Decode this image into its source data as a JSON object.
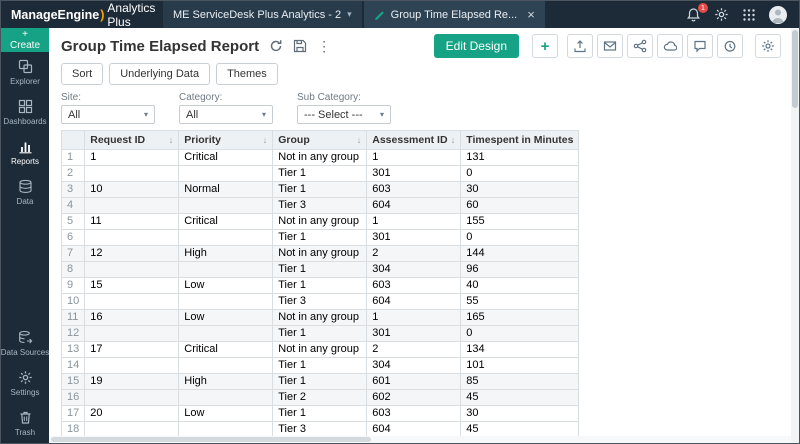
{
  "colors": {
    "topbar_bg": "#1d2b38",
    "accent_teal": "#16a385",
    "brand_orange": "#f7a800",
    "badge_red": "#e64a45",
    "header_bg": "#eef1f3",
    "row_alt_bg": "#f4f6f8",
    "grid_border": "#d9dee3"
  },
  "topbar": {
    "brand": "ManageEngine",
    "brand_accent": ")",
    "product": "Analytics Plus",
    "workspace_tab_label": "ME ServiceDesk Plus Analytics - 2",
    "workspace_caret": "▾",
    "report_tab_label": "Group Time Elapsed Re...",
    "close_glyph": "×",
    "notification_badge": "1"
  },
  "sidebar": {
    "create_label": "+ Create",
    "items": [
      {
        "label": "Explorer"
      },
      {
        "label": "Dashboards"
      },
      {
        "label": "Reports"
      },
      {
        "label": "Data"
      },
      {
        "label": "Data Sources"
      },
      {
        "label": "Settings"
      },
      {
        "label": "Trash"
      }
    ]
  },
  "report": {
    "title": "Group Time Elapsed Report",
    "more_glyph": "⋮",
    "edit_design_label": "Edit Design",
    "plus_glyph": "+",
    "action_buttons": [
      "Sort",
      "Underlying Data",
      "Themes"
    ]
  },
  "filters": {
    "site": {
      "label": "Site:",
      "value": "All"
    },
    "category": {
      "label": "Category:",
      "value": "All"
    },
    "sub_category": {
      "label": "Sub Category:",
      "value": "--- Select ---"
    }
  },
  "table": {
    "sort_glyph": "↓",
    "headers": [
      "Request ID",
      "Priority",
      "Group",
      "Assessment ID",
      "Timespent in Minutes"
    ],
    "rows": [
      {
        "n": "1",
        "cells": [
          "1",
          "Critical",
          "Not in any group",
          "1",
          "131"
        ]
      },
      {
        "n": "2",
        "cells": [
          "",
          "",
          "Tier 1",
          "301",
          "0"
        ]
      },
      {
        "n": "3",
        "cells": [
          "10",
          "Normal",
          "Tier 1",
          "603",
          "30"
        ]
      },
      {
        "n": "4",
        "cells": [
          "",
          "",
          "Tier 3",
          "604",
          "60"
        ]
      },
      {
        "n": "5",
        "cells": [
          "11",
          "Critical",
          "Not in any group",
          "1",
          "155"
        ]
      },
      {
        "n": "6",
        "cells": [
          "",
          "",
          "Tier 1",
          "301",
          "0"
        ]
      },
      {
        "n": "7",
        "cells": [
          "12",
          "High",
          "Not in any group",
          "2",
          "144"
        ]
      },
      {
        "n": "8",
        "cells": [
          "",
          "",
          "Tier 1",
          "304",
          "96"
        ]
      },
      {
        "n": "9",
        "cells": [
          "15",
          "Low",
          "Tier 1",
          "603",
          "40"
        ]
      },
      {
        "n": "10",
        "cells": [
          "",
          "",
          "Tier 3",
          "604",
          "55"
        ]
      },
      {
        "n": "11",
        "cells": [
          "16",
          "Low",
          "Not in any group",
          "1",
          "165"
        ]
      },
      {
        "n": "12",
        "cells": [
          "",
          "",
          "Tier 1",
          "301",
          "0"
        ]
      },
      {
        "n": "13",
        "cells": [
          "17",
          "Critical",
          "Not in any group",
          "2",
          "134"
        ]
      },
      {
        "n": "14",
        "cells": [
          "",
          "",
          "Tier 1",
          "304",
          "101"
        ]
      },
      {
        "n": "15",
        "cells": [
          "19",
          "High",
          "Tier 1",
          "601",
          "85"
        ]
      },
      {
        "n": "16",
        "cells": [
          "",
          "",
          "Tier 2",
          "602",
          "45"
        ]
      },
      {
        "n": "17",
        "cells": [
          "20",
          "Low",
          "Tier 1",
          "603",
          "30"
        ]
      },
      {
        "n": "18",
        "cells": [
          "",
          "",
          "Tier 3",
          "604",
          "45"
        ]
      }
    ]
  }
}
